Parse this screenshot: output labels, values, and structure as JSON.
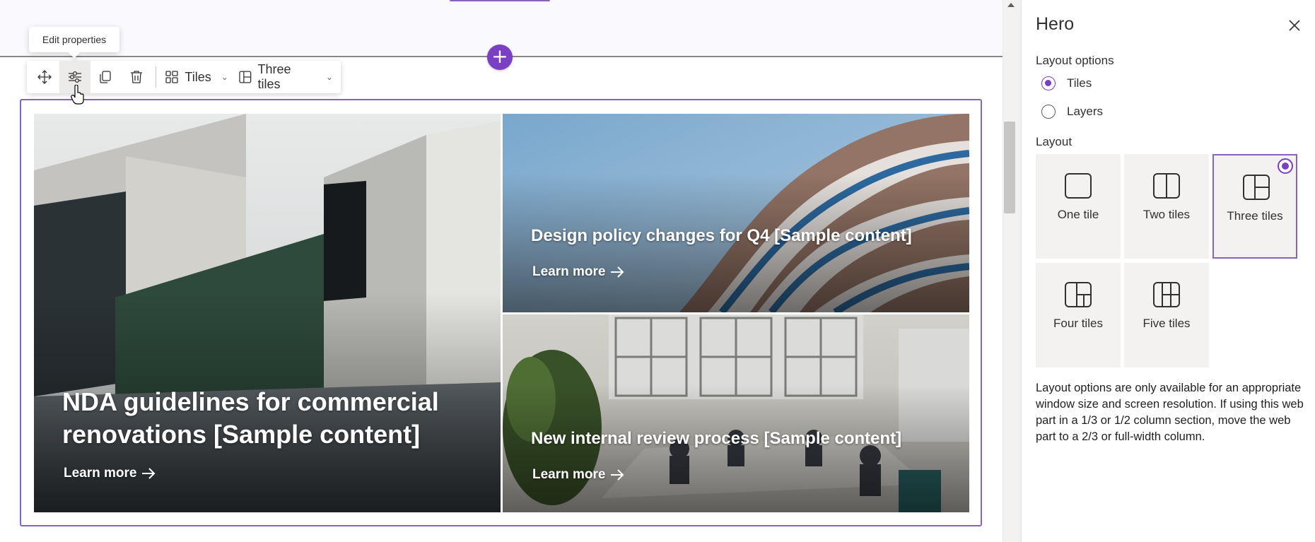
{
  "tooltip": {
    "text": "Edit properties"
  },
  "toolbar": {
    "layout_label": "Tiles",
    "layout_icon": "tiles-layout-icon",
    "tiles_count_label": "Three tiles",
    "tiles_count_icon": "three-tiles-icon"
  },
  "tiles": [
    {
      "title": "NDA guidelines for commercial renovations [Sample content]",
      "link": "Learn more"
    },
    {
      "title": "Design policy changes for Q4 [Sample content]",
      "link": "Learn more"
    },
    {
      "title": "New internal review process [Sample content]",
      "link": "Learn more"
    }
  ],
  "pane": {
    "title": "Hero",
    "layout_options_label": "Layout options",
    "options": [
      {
        "label": "Tiles",
        "checked": true
      },
      {
        "label": "Layers",
        "checked": false
      }
    ],
    "layout_label": "Layout",
    "layouts": [
      {
        "label": "One tile",
        "selected": false
      },
      {
        "label": "Two tiles",
        "selected": false
      },
      {
        "label": "Three tiles",
        "selected": true
      },
      {
        "label": "Four tiles",
        "selected": false
      },
      {
        "label": "Five tiles",
        "selected": false
      }
    ],
    "note": "Layout options are only available for an appropriate window size and screen resolution. If using this web part in a 1/3 or 1/2 column section, move the web part to a 2/3 or full-width column."
  },
  "colors": {
    "accent": "#8764b8",
    "add_button": "#7b3fc4",
    "tile_background": "#f3f2f1"
  }
}
